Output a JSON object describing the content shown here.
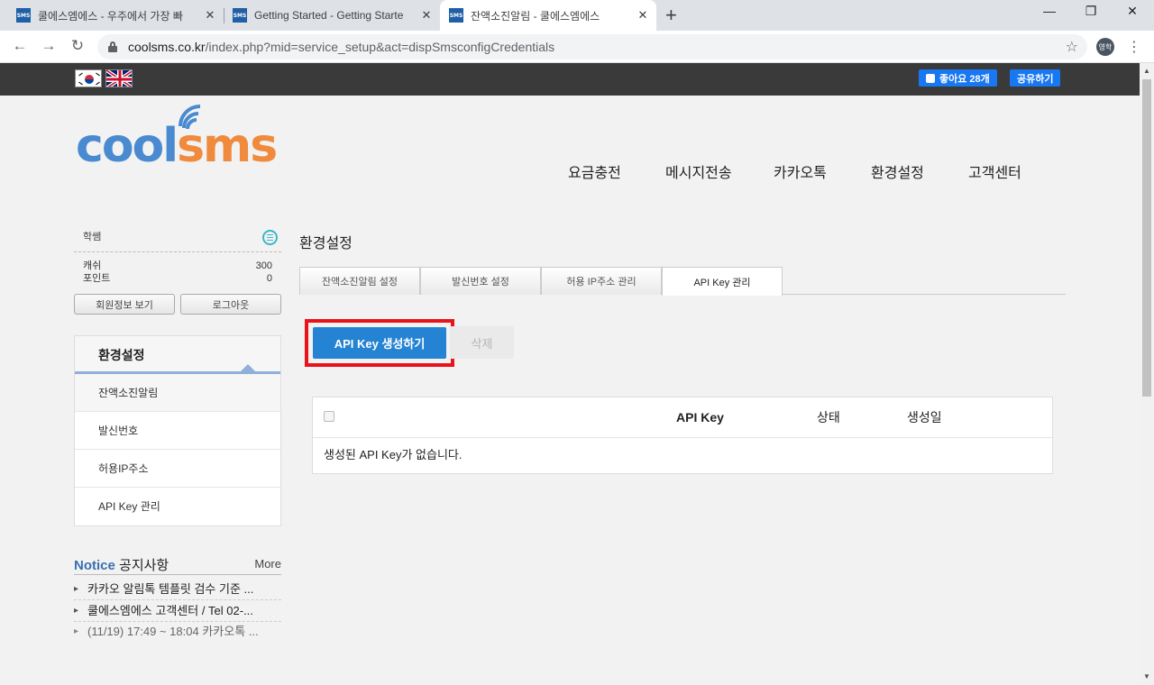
{
  "browser": {
    "tabs": [
      {
        "favicon": "SMS",
        "title": "쿨에스엠에스 - 우주에서 가장 빠",
        "close": "✕"
      },
      {
        "favicon": "SMS",
        "title": "Getting Started - Getting Starte",
        "close": "✕"
      },
      {
        "favicon": "SMS",
        "title": "잔액소진알림 - 쿨에스엠에스",
        "close": "✕"
      }
    ],
    "new_tab": "+",
    "window_controls": {
      "minimize": "—",
      "restore": "❐",
      "close": "✕"
    },
    "nav": {
      "back": "←",
      "forward": "→",
      "reload": "↻"
    },
    "url_host": "coolsms.co.kr",
    "url_rest": "/index.php?mid=service_setup&act=dispSmsconfigCredentials",
    "bookmark": "☆",
    "profile": "영학",
    "menu": "⋮"
  },
  "top": {
    "fb_like": "좋아요 28개",
    "fb_share": "공유하기"
  },
  "logo": {
    "part1": "cool",
    "part2": "sms"
  },
  "gnb": [
    "요금충전",
    "메시지전송",
    "카카오톡",
    "환경설정",
    "고객센터"
  ],
  "user": {
    "name": "학쌤",
    "cash_label": "캐쉬",
    "cash_value": "300",
    "point_label": "포인트",
    "point_value": "0",
    "btn_profile": "회원정보 보기",
    "btn_logout": "로그아웃"
  },
  "sidemenu": {
    "title": "환경설정",
    "items": [
      "잔액소진알림",
      "발신번호",
      "허용IP주소",
      "API Key 관리"
    ]
  },
  "notice": {
    "title_en": "Notice",
    "title_ko": "공지사항",
    "more": "More",
    "items": [
      "카카오 알림톡 템플릿 검수 기준 ...",
      "쿨에스엠에스 고객센터 / Tel 02-...",
      "(11/19) 17:49 ~ 18:04 카카오톡 ..."
    ]
  },
  "main": {
    "title": "환경설정",
    "tabs": [
      "잔액소진알림 설정",
      "발신번호 설정",
      "허용 IP주소 관리",
      "API Key 관리"
    ],
    "btn_create": "API Key 생성하기",
    "btn_delete": "삭제",
    "table": {
      "headers": [
        "API Key",
        "상태",
        "생성일"
      ],
      "empty": "생성된 API Key가 없습니다."
    }
  },
  "colors": {
    "accent": "#2583d3",
    "highlight": "#e8131b",
    "logo_blue": "#4a8ad0",
    "logo_orange": "#f08a3c"
  }
}
